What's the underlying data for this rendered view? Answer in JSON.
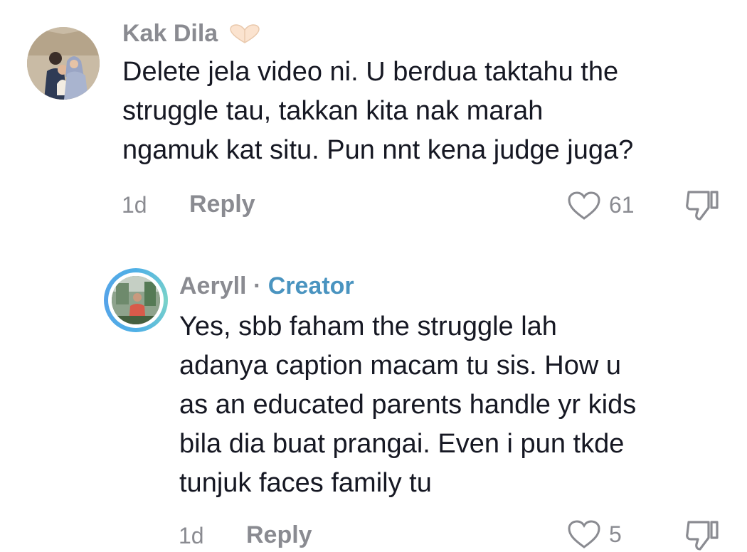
{
  "comment": {
    "username": "Kak Dila",
    "lines": [
      "Delete jela video ni. U berdua taktahu the",
      "struggle tau, takkan kita nak marah",
      "ngamuk kat situ. Pun nnt kena judge juga?"
    ],
    "time": "1d",
    "reply_label": "Reply",
    "likes": "61"
  },
  "reply": {
    "username": "Aeryll",
    "separator": " · ",
    "badge": "Creator",
    "lines": [
      "Yes, sbb faham the struggle lah",
      "adanya caption macam tu sis. How u",
      "as an educated parents handle yr kids",
      "bila dia buat prangai. Even i pun tkde",
      "tunjuk faces family tu"
    ],
    "time": "1d",
    "reply_label": "Reply",
    "likes": "5"
  },
  "colors": {
    "text": "#161823",
    "muted": "#8a8b91",
    "creator": "#4a94c0",
    "ring": "#4fb0e6"
  },
  "icons": {
    "name_badge": "heart-hands-emoji-icon",
    "like": "heart-outline-icon",
    "dislike": "thumbs-down-icon"
  }
}
